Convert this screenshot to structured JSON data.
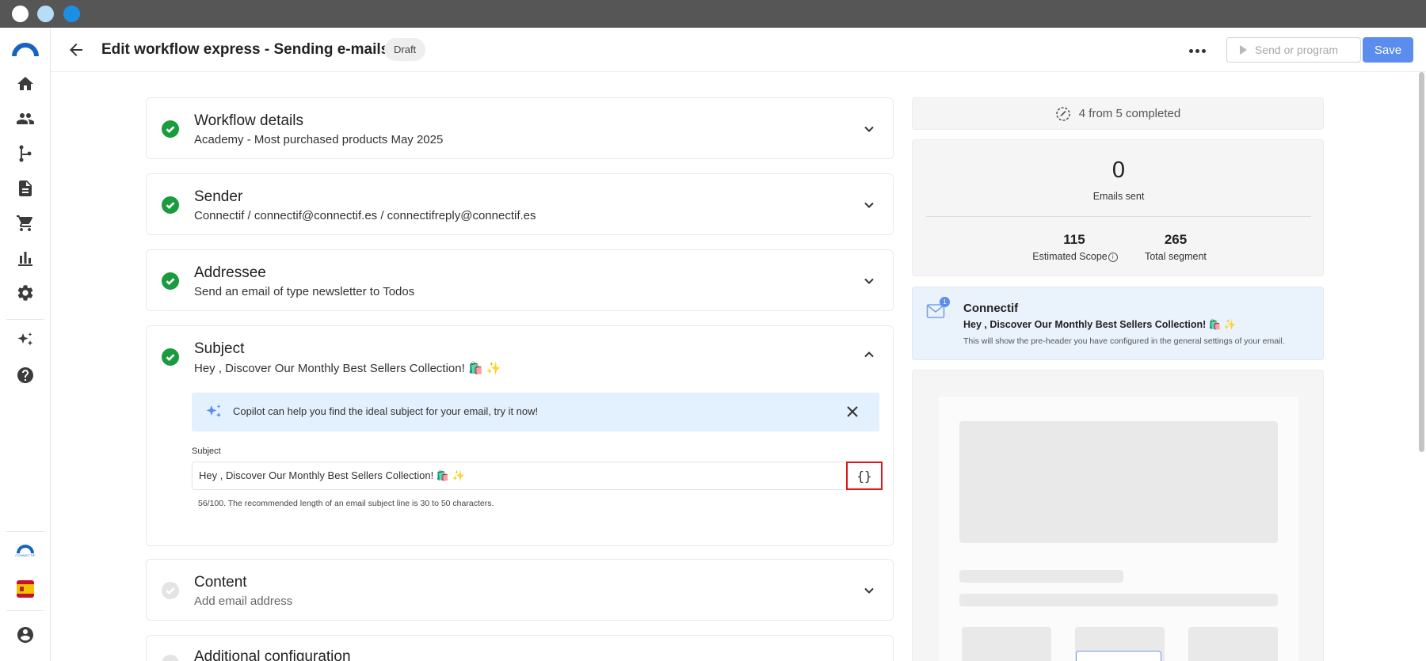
{
  "header": {
    "title": "Edit workflow express - Sending e-mails",
    "status_badge": "Draft",
    "send_label": "Send or program",
    "save_label": "Save"
  },
  "sections": [
    {
      "title": "Workflow details",
      "subtitle": "Academy - Most purchased products May 2025",
      "completed": true,
      "expanded": false
    },
    {
      "title": "Sender",
      "subtitle": "Connectif / connectif@connectif.es / connectifreply@connectif.es",
      "completed": true,
      "expanded": false
    },
    {
      "title": "Addressee",
      "subtitle": "Send an email of type newsletter to Todos",
      "completed": true,
      "expanded": false
    },
    {
      "title": "Subject",
      "subtitle": "Hey , Discover Our Monthly Best Sellers Collection! 🛍️ ✨",
      "completed": true,
      "expanded": true
    },
    {
      "title": "Content",
      "subtitle": "Add email address",
      "completed": false,
      "expanded": false
    },
    {
      "title": "Additional configuration",
      "subtitle": "",
      "completed": false,
      "expanded": false
    }
  ],
  "subject_editor": {
    "copilot_hint": "Copilot can help you find the ideal subject for your email, try it now!",
    "field_label": "Subject",
    "value": "Hey , Discover Our Monthly Best Sellers Collection! 🛍️ ✨",
    "variables_button": "{}",
    "helper": "56/100. The recommended length of an email subject line is 30 to 50 characters."
  },
  "progress": {
    "text": "4 from 5 completed",
    "completed": 4,
    "total": 5
  },
  "stats": {
    "emails_sent_value": "0",
    "emails_sent_label": "Emails sent",
    "estimated_scope_value": "115",
    "estimated_scope_label": "Estimated Scope",
    "total_segment_value": "265",
    "total_segment_label": "Total segment"
  },
  "inbox_preview": {
    "badge": "1",
    "sender": "Connectif",
    "subject": "Hey , Discover Our Monthly Best Sellers Collection! 🛍️ ✨",
    "preheader": "This will show the pre-header you have configured in the general settings of your email."
  },
  "sidebar": {
    "items": [
      "home-icon",
      "contacts-icon",
      "workflows-icon",
      "content-icon",
      "store-icon",
      "reports-icon",
      "settings-icon",
      "copilot-icon",
      "help-icon"
    ],
    "brand_caption": "CONNECTIF",
    "language": "es"
  },
  "colors": {
    "accent": "#5b8def",
    "success": "#1a9c3e",
    "highlight": "#e01414"
  }
}
